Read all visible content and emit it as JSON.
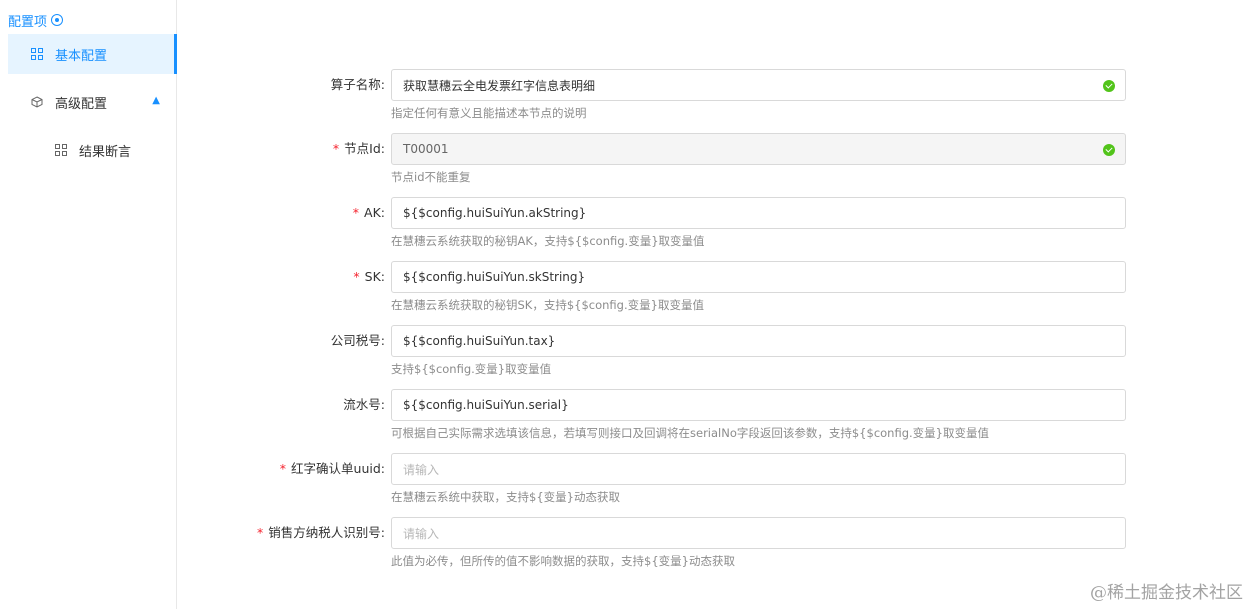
{
  "sidebar": {
    "header": "配置项",
    "items": [
      {
        "label": "基本配置"
      },
      {
        "label": "高级配置"
      },
      {
        "label": "结果断言"
      }
    ]
  },
  "form": {
    "fields": [
      {
        "label": "算子名称:",
        "required": false,
        "value": "获取慧穗云全电发票红字信息表明细",
        "help": "指定任何有意义且能描述本节点的说明"
      },
      {
        "label": "节点Id:",
        "required": true,
        "value": "T00001",
        "help": "节点id不能重复"
      },
      {
        "label": "AK:",
        "required": true,
        "value": "${$config.huiSuiYun.akString}",
        "help": "在慧穗云系统获取的秘钥AK，支持${$config.变量}取变量值"
      },
      {
        "label": "SK:",
        "required": true,
        "value": "${$config.huiSuiYun.skString}",
        "help": "在慧穗云系统获取的秘钥SK，支持${$config.变量}取变量值"
      },
      {
        "label": "公司税号:",
        "required": false,
        "value": "${$config.huiSuiYun.tax}",
        "help": "支持${$config.变量}取变量值"
      },
      {
        "label": "流水号:",
        "required": false,
        "value": "${$config.huiSuiYun.serial}",
        "help": "可根据自己实际需求选填该信息，若填写则接口及回调将在serialNo字段返回该参数，支持${$config.变量}取变量值"
      },
      {
        "label": "红字确认单uuid:",
        "required": true,
        "placeholder": "请输入",
        "help": "在慧穗云系统中获取，支持${变量}动态获取"
      },
      {
        "label": "销售方纳税人识别号:",
        "required": true,
        "placeholder": "请输入",
        "help": "此值为必传，但所传的值不影响数据的获取，支持${变量}动态获取"
      }
    ]
  },
  "watermark": "@稀土掘金技术社区",
  "colors": {
    "accent": "#1890ff",
    "success": "#52c41a",
    "required": "#f5222d"
  }
}
